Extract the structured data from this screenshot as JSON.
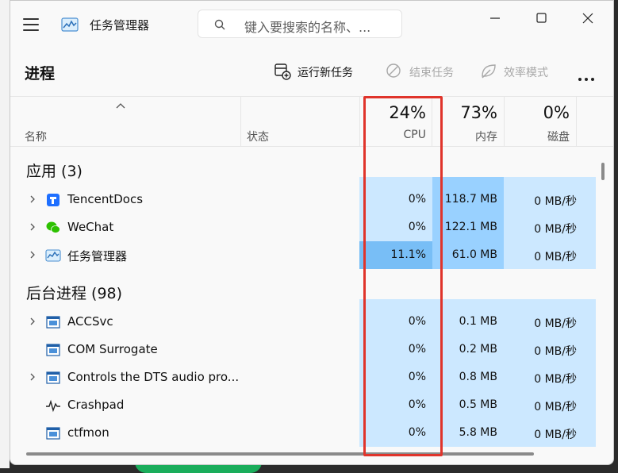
{
  "window": {
    "title": "任务管理器",
    "search_placeholder": "键入要搜索的名称、..."
  },
  "toolbar": {
    "page_title": "进程",
    "run_new_task": "运行新任务",
    "end_task": "结束任务",
    "efficiency_mode": "效率模式"
  },
  "columns": {
    "name": "名称",
    "status": "状态",
    "cpu_label": "CPU",
    "cpu_pct": "24%",
    "mem_label": "内存",
    "mem_pct": "73%",
    "disk_label": "磁盘",
    "disk_pct": "0%"
  },
  "groups": {
    "apps": "应用 (3)",
    "background": "后台进程 (98)"
  },
  "apps": [
    {
      "name": "TencentDocs",
      "cpu": "0%",
      "mem": "118.7 MB",
      "disk": "0 MB/秒"
    },
    {
      "name": "WeChat",
      "cpu": "0%",
      "mem": "122.1 MB",
      "disk": "0 MB/秒"
    },
    {
      "name": "任务管理器",
      "cpu": "11.1%",
      "mem": "61.0 MB",
      "disk": "0 MB/秒"
    }
  ],
  "background": [
    {
      "name": "ACCSvc",
      "cpu": "0%",
      "mem": "0.1 MB",
      "disk": "0 MB/秒"
    },
    {
      "name": "COM Surrogate",
      "cpu": "0%",
      "mem": "0.2 MB",
      "disk": "0 MB/秒"
    },
    {
      "name": "Controls the DTS audio pro...",
      "cpu": "0%",
      "mem": "0.8 MB",
      "disk": "0 MB/秒"
    },
    {
      "name": "Crashpad",
      "cpu": "0%",
      "mem": "0.5 MB",
      "disk": "0 MB/秒"
    },
    {
      "name": "ctfmon",
      "cpu": "0%",
      "mem": "5.8 MB",
      "disk": "0 MB/秒"
    }
  ],
  "colors": {
    "cell_light": "#cce8ff",
    "cell_mem": "#99d1ff",
    "cell_hot": "#78bef6",
    "highlight": "#e0342b"
  }
}
